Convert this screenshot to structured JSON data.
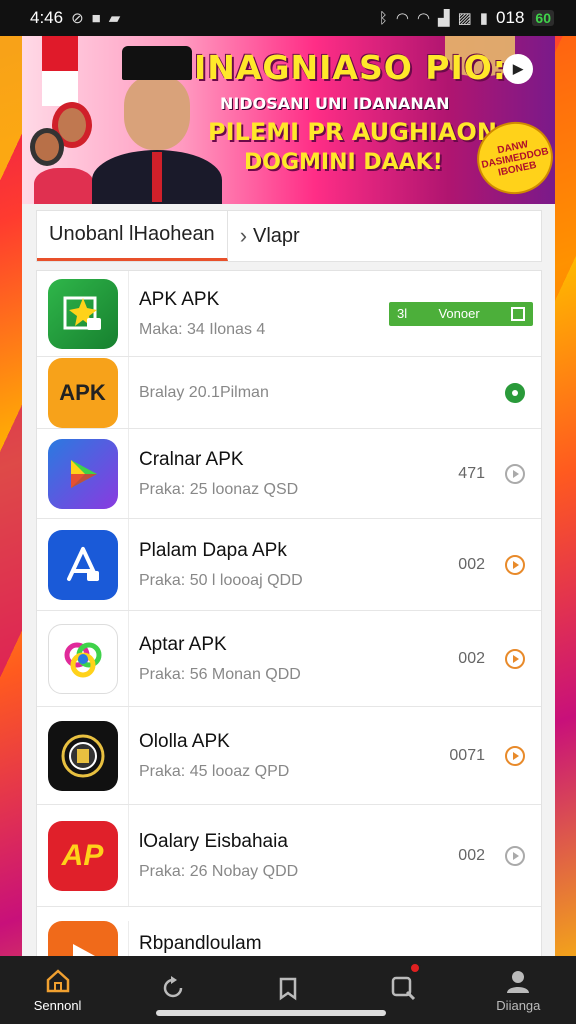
{
  "status_bar": {
    "time": "4:46",
    "battery_text": "018",
    "battery_level": "60"
  },
  "banner": {
    "title": "INAGNIASO PIO:",
    "subtitle": "NIDOSANI UNI IDANANAN",
    "line3": "PILEMI PR AUGHIAON",
    "line4": "DOGMINI DAAK!",
    "badge_text": "DANW DASIMEDDOB IBONEB",
    "play_icon": "play-icon"
  },
  "tabs": [
    {
      "label": "Unobanl lHaohean"
    },
    {
      "label": "Vlapr",
      "icon": "chevron-right-icon"
    }
  ],
  "apps": [
    {
      "name": "APK APK",
      "sub": "Maka: 34 Ilonas 4",
      "count": "",
      "status": "badge",
      "badge_left": "3l",
      "badge_mid": "Vonoer",
      "icon_text": "",
      "colors": [
        "#1f9a3a",
        "#ffffff"
      ]
    },
    {
      "name": "",
      "sub": "Bralay 20.1Pilman",
      "count": "",
      "status": "green",
      "icon_text": "APK",
      "colors": [
        "#f7a21a",
        "#222222"
      ]
    },
    {
      "name": "Cralnar APK",
      "sub": "Praka: 25 loonaz QSD",
      "count": "471",
      "status": "grey",
      "icon_text": "",
      "colors": [
        "#2a7ae0",
        "#ffffff"
      ]
    },
    {
      "name": "Plalam Dapa APk",
      "sub": "Praka: 50 l loooaj QDD",
      "count": "002",
      "status": "orange",
      "icon_text": "",
      "colors": [
        "#1a5ad8",
        "#ffffff"
      ]
    },
    {
      "name": "Aptar APK",
      "sub": "Praka: 56 Monan QDD",
      "count": "002",
      "status": "orange",
      "icon_text": "",
      "colors": [
        "#ffffff",
        "#c0209a"
      ]
    },
    {
      "name": "Ololla APK",
      "sub": "Praka: 45 looaz QPD",
      "count": "0071",
      "status": "orange",
      "icon_text": "",
      "colors": [
        "#111111",
        "#e8c040"
      ]
    },
    {
      "name": "lOalary Eisbahaia",
      "sub": "Praka: 26 Nobay QDD",
      "count": "002",
      "status": "grey",
      "icon_text": "AP",
      "colors": [
        "#e0202a",
        "#ffd21a"
      ]
    },
    {
      "name": "Rbpandloulam",
      "sub": "",
      "count": "",
      "status": "none",
      "icon_text": "",
      "colors": [
        "#f06a1a",
        "#ffffff"
      ]
    }
  ],
  "bottom_nav": [
    {
      "label": "Sennonl",
      "icon": "home-icon",
      "active": true
    },
    {
      "label": "",
      "icon": "refresh-icon",
      "active": false
    },
    {
      "label": "",
      "icon": "bookmark-icon",
      "active": false
    },
    {
      "label": "",
      "icon": "search-notification-icon",
      "active": false,
      "badge": true
    },
    {
      "label": "Diianga",
      "icon": "profile-icon",
      "active": false
    }
  ]
}
